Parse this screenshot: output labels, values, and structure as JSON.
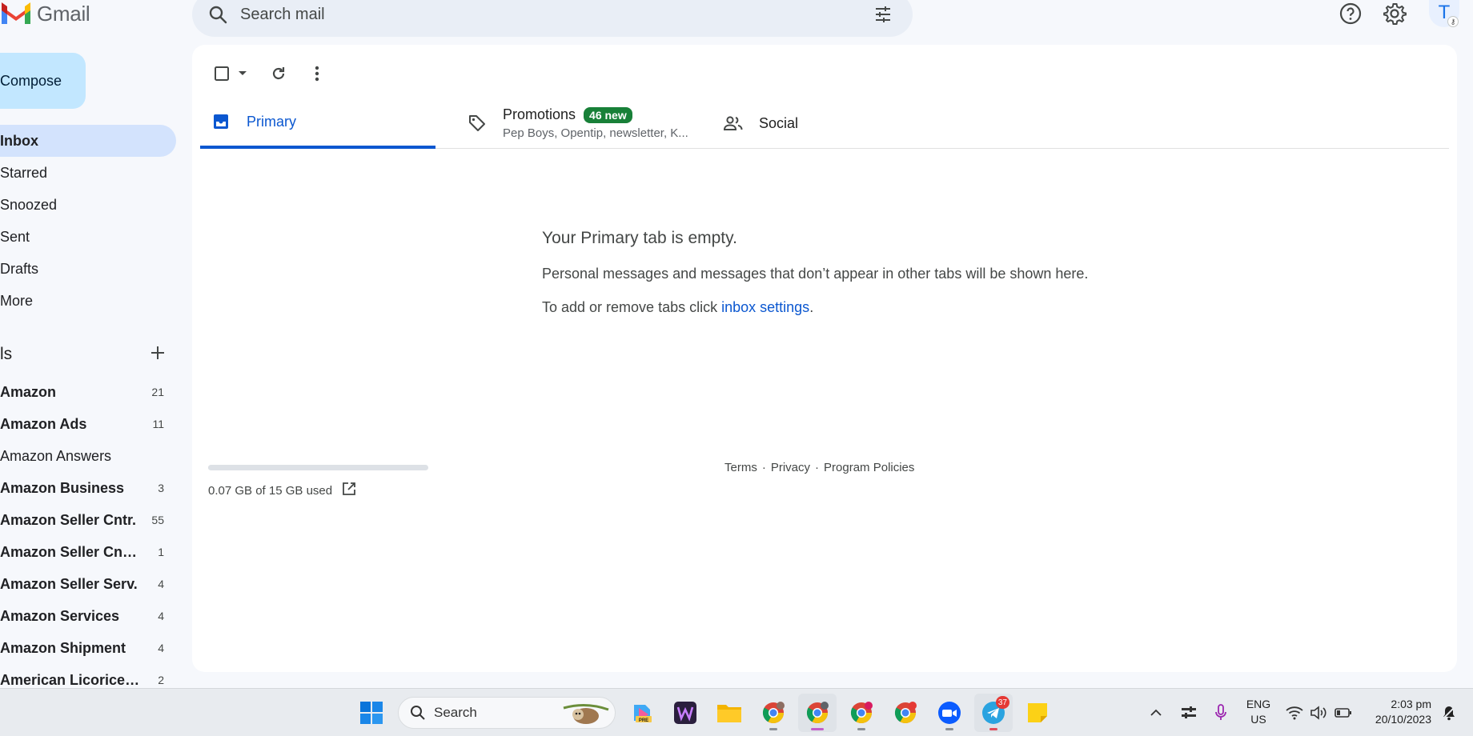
{
  "app": {
    "name": "Gmail"
  },
  "search": {
    "placeholder": "Search mail"
  },
  "header": {
    "avatar_letter": "T"
  },
  "compose": {
    "label": "Compose"
  },
  "nav": [
    {
      "label": "Inbox",
      "active": true
    },
    {
      "label": "Starred"
    },
    {
      "label": "Snoozed"
    },
    {
      "label": "Sent"
    },
    {
      "label": "Drafts"
    },
    {
      "label": "More"
    }
  ],
  "labels": {
    "heading": "ls",
    "items": [
      {
        "name": "Amazon",
        "count": "21",
        "bold": true
      },
      {
        "name": "Amazon Ads",
        "count": "11",
        "bold": true
      },
      {
        "name": "Amazon Answers",
        "count": "",
        "bold": false
      },
      {
        "name": "Amazon Business",
        "count": "3",
        "bold": true
      },
      {
        "name": "Amazon Seller Cntr.",
        "count": "55",
        "bold": true
      },
      {
        "name": "Amazon Seller Cntr...",
        "count": "1",
        "bold": true
      },
      {
        "name": "Amazon Seller Serv.",
        "count": "4",
        "bold": true
      },
      {
        "name": "Amazon Services",
        "count": "4",
        "bold": true
      },
      {
        "name": "Amazon Shipment",
        "count": "4",
        "bold": true
      },
      {
        "name": "American Licorice ...",
        "count": "2",
        "bold": true
      }
    ]
  },
  "tabs": {
    "primary": {
      "label": "Primary"
    },
    "promotions": {
      "label": "Promotions",
      "badge": "46 new",
      "senders": "Pep Boys, Opentip, newsletter, K..."
    },
    "social": {
      "label": "Social"
    }
  },
  "empty_state": {
    "title": "Your Primary tab is empty.",
    "line1": "Personal messages and messages that don’t appear in other tabs will be shown here.",
    "line2_prefix": "To add or remove tabs click ",
    "line2_link": "inbox settings",
    "line2_suffix": "."
  },
  "storage": {
    "used_text": "0.07 GB of 15 GB used",
    "fraction": 0.005
  },
  "footer": {
    "terms": "Terms",
    "sep": "·",
    "privacy": "Privacy",
    "policies": "Program Policies"
  },
  "taskbar": {
    "search_label": "Search",
    "telegram_badge": "37",
    "lang_line1": "ENG",
    "lang_line2": "US",
    "time": "2:03 pm",
    "date": "20/10/2023"
  },
  "colors": {
    "accent": "#0b57d0",
    "compose_bg": "#c2e7ff",
    "inbox_active": "#d3e3fd",
    "badge_green": "#188038"
  }
}
